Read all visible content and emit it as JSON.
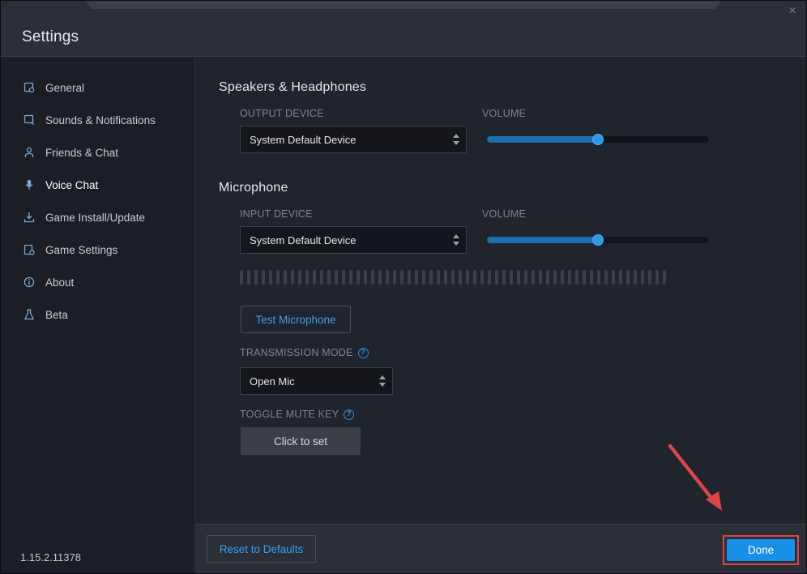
{
  "window": {
    "title": "Settings",
    "close_glyph": "×"
  },
  "sidebar": {
    "items": [
      {
        "label": "General",
        "icon": "general-icon",
        "active": false
      },
      {
        "label": "Sounds & Notifications",
        "icon": "sounds-icon",
        "active": false
      },
      {
        "label": "Friends & Chat",
        "icon": "friends-icon",
        "active": false
      },
      {
        "label": "Voice Chat",
        "icon": "microphone-icon",
        "active": true
      },
      {
        "label": "Game Install/Update",
        "icon": "download-icon",
        "active": false
      },
      {
        "label": "Game Settings",
        "icon": "game-settings-icon",
        "active": false
      },
      {
        "label": "About",
        "icon": "info-icon",
        "active": false
      },
      {
        "label": "Beta",
        "icon": "flask-icon",
        "active": false
      }
    ],
    "version": "1.15.2.11378"
  },
  "speakers": {
    "title": "Speakers & Headphones",
    "output_label": "OUTPUT DEVICE",
    "output_value": "System Default Device",
    "volume_label": "VOLUME",
    "volume_level": 0.5
  },
  "microphone": {
    "title": "Microphone",
    "input_label": "INPUT DEVICE",
    "input_value": "System Default Device",
    "volume_label": "VOLUME",
    "volume_level": 0.5,
    "test_button": "Test Microphone",
    "transmission_label": "TRANSMISSION MODE",
    "transmission_value": "Open Mic",
    "mute_key_label": "TOGGLE MUTE KEY",
    "mute_key_button": "Click to set"
  },
  "footer": {
    "reset_label": "Reset to Defaults",
    "done_label": "Done"
  },
  "colors": {
    "accent": "#1a8fe6",
    "annotation": "#d9464a"
  }
}
